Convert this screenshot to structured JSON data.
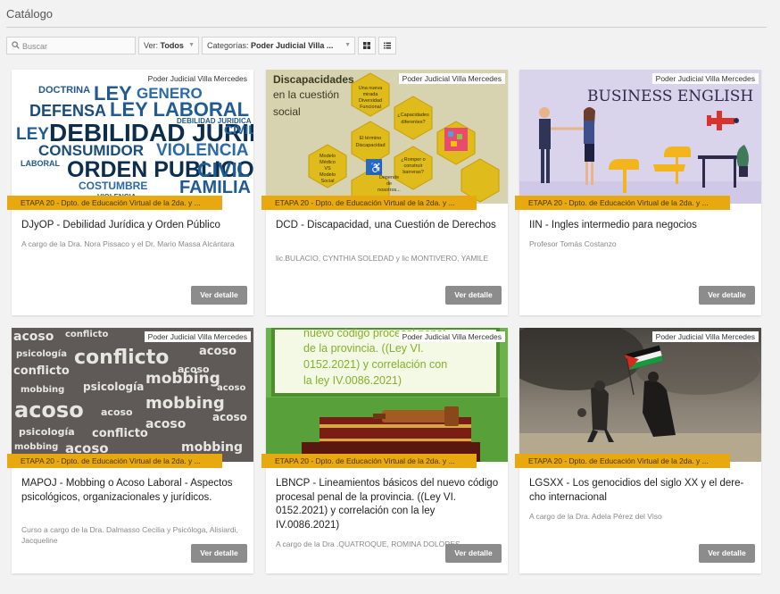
{
  "page": {
    "title": "Catálogo"
  },
  "toolbar": {
    "search_placeholder": "Buscar",
    "ver_prefix": "Ver:",
    "ver_value": "Todos",
    "cat_prefix": "Categorías:",
    "cat_value": "Poder Judicial Villa ..."
  },
  "colors": {
    "etapa": "#e8a80f",
    "button": "#8c8c8c",
    "background": "#f2f2f2"
  },
  "cards": [
    {
      "category": "Poder Judicial Villa Mercedes",
      "etapa": "ETAPA 20 - Dpto. de Educación Virtual de la 2da. y ...",
      "title": "DJyOP - Debilidad Jurídica y Orden Público",
      "sub": "A cargo de la Dra. Nora Pissaco y el Dr. Mario Massa Alcántara",
      "button": "Ver detalle",
      "image": "word-cloud-legal-terms"
    },
    {
      "category": "Poder Judicial Villa Mercedes",
      "etapa": "ETAPA 20 - Dpto. de Educación Virtual de la 2da. y ...",
      "title": "DCD - Discapacidad, una Cuestión de Derechos",
      "sub": "lic.BULACIO, CYNTHIA SOLEDAD y lic MONTIVERO, YAMILE",
      "button": "Ver detalle",
      "image": "hexagon-infographic",
      "image_text": {
        "heading": [
          "Discapacidades",
          "en la cuestión",
          "social"
        ],
        "h1": [
          "Una nueva",
          "mirada",
          "Diversidad",
          "Funcional"
        ],
        "h2": [
          "¿Capacidades",
          "diferentes?"
        ],
        "h3": [
          "El término",
          "Discapacidad"
        ],
        "h4": [
          "Modelo",
          "Médico",
          "VS",
          "Modelo",
          "Social"
        ],
        "h5": [
          "Depende",
          "de",
          "nosotros..."
        ],
        "h6": [
          "¿Romper o",
          "construir",
          "barreras?"
        ]
      }
    },
    {
      "category": "Poder Judicial Villa Mercedes",
      "etapa": "ETAPA 20 - Dpto. de Educación Virtual de la 2da. y ...",
      "title": "IIN - Ingles intermedio para negocios",
      "sub": "Profesor Tomás Costanzo",
      "button": "Ver detalle",
      "image": "business-english-illustration",
      "image_text": {
        "heading": "BUSINESS ENGLISH"
      }
    },
    {
      "category": "Poder Judicial Villa Mercedes",
      "etapa": "ETAPA 20 - Dpto. de Educación Virtual de la 2da. y ...",
      "title": "MAPOJ - Mobbing o Acoso Laboral - Aspectos psicológicos, organizacionales y jurídicos.",
      "sub": "Curso a cargo de la Dra. Dalmasso Cecilia y Psicóloga, Alisiardi, Jacqueline",
      "button": "Ver detalle",
      "image": "word-collage-mobbing"
    },
    {
      "category": "Poder Judicial Villa Mercedes",
      "etapa": "ETAPA 20 - Dpto. de Educación Virtual de la 2da. y ...",
      "title": "LBNCP - Lineamientos básicos del nuevo có­digo procesal penal de la provincia. ((Ley VI. 0152.2021) y correlación con la ley IV.0086.2021)",
      "sub": "A cargo de la Dra .QUATROQUE, ROMINA DOLORES",
      "button": "Ver detalle",
      "image": "chalkboard-gavel",
      "image_text": [
        "nuevo código procesal penal",
        "de la provincia. ((Ley VI.",
        "0152.2021) y correlación con",
        "la ley IV.0086.2021)"
      ]
    },
    {
      "category": "Poder Judicial Villa Mercedes",
      "etapa": "ETAPA 20 - Dpto. de Educación Virtual de la 2da. y ...",
      "title": "LGSXX - Los genocidios del siglo XX y el dere­cho internacional",
      "sub": "A cargo de la Dra. Adela Pérez del Viso",
      "button": "Ver detalle",
      "image": "photo-flag-smoke"
    }
  ]
}
